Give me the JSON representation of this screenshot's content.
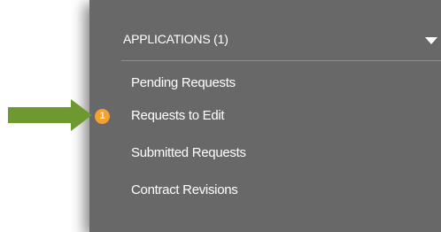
{
  "menu": {
    "header": "APPLICATIONS (1)",
    "items": [
      {
        "label": "Pending Requests"
      },
      {
        "label": "Requests to Edit",
        "badge": "1"
      },
      {
        "label": "Submitted Requests"
      },
      {
        "label": "Contract Revisions"
      }
    ]
  },
  "icons": {
    "expand": "chevron-down-icon",
    "pointer": "green-arrow-icon"
  },
  "colors": {
    "panel_bg": "#686868",
    "badge": "#f6a12c",
    "arrow": "#6d9930"
  }
}
